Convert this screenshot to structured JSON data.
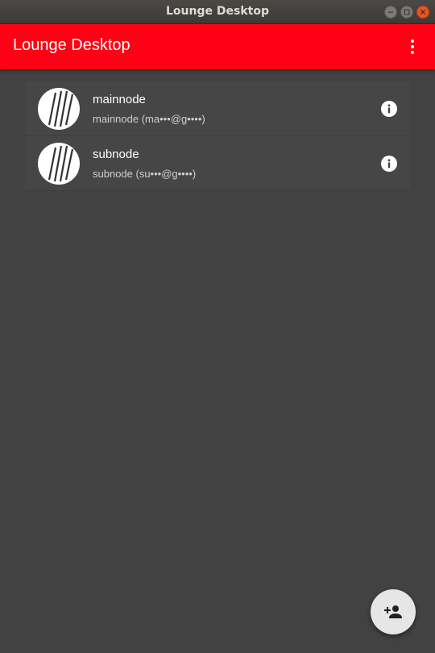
{
  "window": {
    "title": "Lounge Desktop"
  },
  "appbar": {
    "title": "Lounge Desktop",
    "accent_color": "#ff0015",
    "menu_icon": "more-vert-icon"
  },
  "accounts": [
    {
      "name": "mainnode",
      "subtitle": "mainnode (ma•••@g••••)"
    },
    {
      "name": "subnode",
      "subtitle": "subnode (su•••@g••••)"
    }
  ],
  "fab": {
    "icon": "person-add-icon"
  }
}
